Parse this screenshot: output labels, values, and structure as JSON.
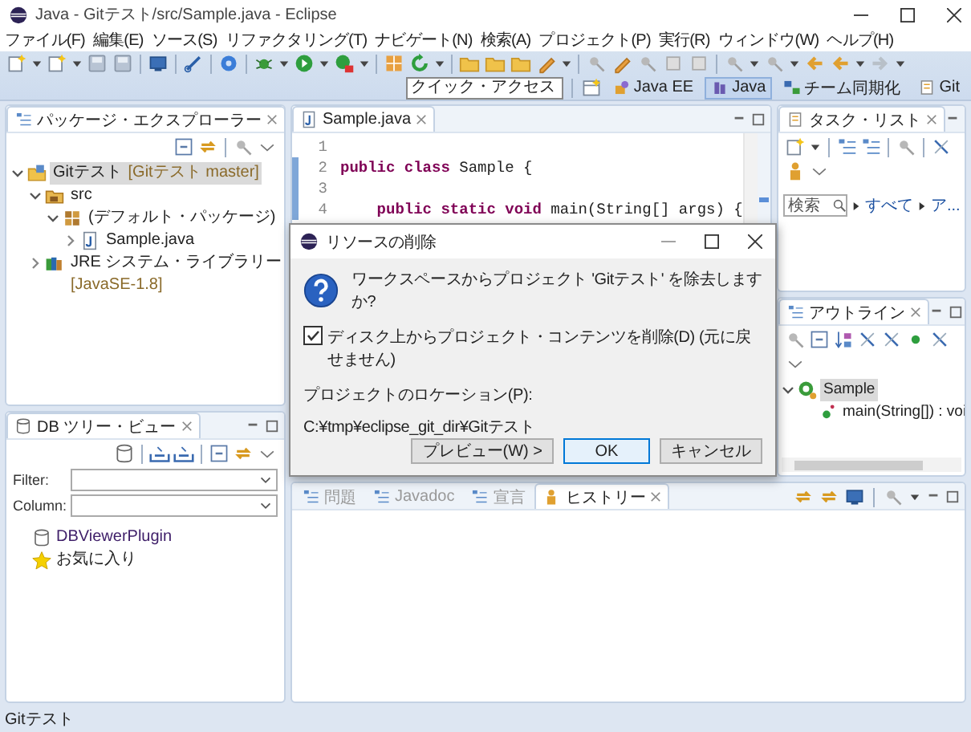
{
  "window": {
    "title": "Java - Gitテスト/src/Sample.java - Eclipse"
  },
  "menu": [
    "ファイル(F)",
    "編集(E)",
    "ソース(S)",
    "リファクタリング(T)",
    "ナビゲート(N)",
    "検索(A)",
    "プロジェクト(P)",
    "実行(R)",
    "ウィンドウ(W)",
    "ヘルプ(H)"
  ],
  "quick_access": {
    "placeholder": "クイック・アクセス"
  },
  "perspectives": [
    {
      "label": "Java EE",
      "selected": false
    },
    {
      "label": "Java",
      "selected": true
    },
    {
      "label": "チーム同期化",
      "selected": false
    },
    {
      "label": "Git",
      "selected": false
    }
  ],
  "package_explorer": {
    "title": "パッケージ・エクスプローラー",
    "tree": [
      {
        "label": "Gitテスト",
        "decoration": "[Gitテスト master]",
        "kind": "project",
        "expanded": true,
        "selected": true,
        "children": [
          {
            "label": "src",
            "kind": "source_folder",
            "expanded": true,
            "selected": false,
            "children": [
              {
                "label": "(デフォルト・パッケージ)",
                "kind": "package",
                "expanded": true,
                "selected": false,
                "children": [
                  {
                    "label": "Sample.java",
                    "kind": "java_file",
                    "expanded": false,
                    "selected": false
                  }
                ]
              }
            ]
          },
          {
            "label": "JRE システム・ライブラリー",
            "decoration": "[JavaSE-1.8]",
            "kind": "library",
            "expanded": false,
            "selected": false
          }
        ]
      }
    ]
  },
  "db_tree": {
    "title": "DB ツリー・ビュー",
    "filter_label": "Filter:",
    "column_label": "Column:",
    "items": [
      {
        "label": "DBViewerPlugin",
        "kind": "database"
      },
      {
        "label": "お気に入り",
        "kind": "favorites"
      }
    ]
  },
  "editor": {
    "tab": "Sample.java",
    "lines": [
      {
        "number": "1"
      },
      {
        "number": "2",
        "tokens": [
          {
            "text": "public class",
            "kind": "keyword"
          },
          {
            "text": " Sample {",
            "kind": "plain"
          }
        ]
      },
      {
        "number": "3"
      },
      {
        "number": "4",
        "tokens": [
          {
            "text": "    public static void",
            "kind": "keyword"
          },
          {
            "text": " main(String[] args) {",
            "kind": "plain"
          }
        ]
      }
    ]
  },
  "task_list": {
    "title": "タスク・リスト",
    "search": {
      "placeholder": "検索"
    },
    "filters": [
      "すべて",
      "ア..."
    ]
  },
  "outline": {
    "title": "アウトライン",
    "tree": [
      {
        "label": "Sample",
        "kind": "class",
        "expanded": true,
        "selected": true,
        "children": [
          {
            "label": "main(String[]) : voi",
            "kind": "method",
            "selected": false
          }
        ]
      }
    ]
  },
  "bottom_tabs": [
    {
      "label": "問題",
      "selected": false
    },
    {
      "label": "Javadoc",
      "selected": false
    },
    {
      "label": "宣言",
      "selected": false
    },
    {
      "label": "ヒストリー",
      "selected": true
    }
  ],
  "dialog": {
    "title": "リソースの削除",
    "message": "ワークスペースからプロジェクト 'Gitテスト' を除去しますか?",
    "checkbox": {
      "label": "ディスク上からプロジェクト・コンテンツを削除(D) (元に戻せません)",
      "checked": true
    },
    "location_label": "プロジェクトのロケーション(P):",
    "location": "C:¥tmp¥eclipse_git_dir¥Gitテスト",
    "buttons": [
      {
        "label": "プレビュー(W) >",
        "default": false
      },
      {
        "label": "OK",
        "default": true
      },
      {
        "label": "キャンセル",
        "default": false
      }
    ]
  },
  "status_bar": {
    "text": "Gitテスト"
  }
}
